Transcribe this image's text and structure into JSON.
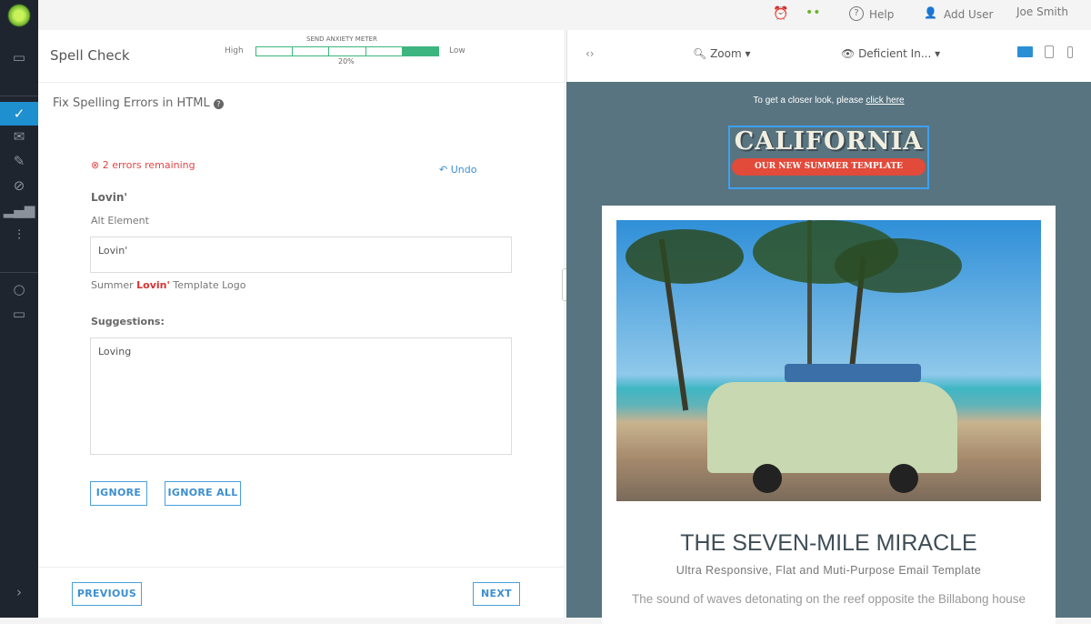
{
  "topbar": {
    "help": "Help",
    "add_user": "Add User",
    "user": "Joe Smith"
  },
  "header": {
    "title": "Spell Check",
    "meter": {
      "title": "SEND ANXIETY METER",
      "high": "High",
      "low": "Low",
      "value_label": "20%",
      "value": 20,
      "segments": 5,
      "filled_segments": 1,
      "color": "#3db57e"
    }
  },
  "section_title": "Fix Spelling Errors in HTML",
  "errors": "2 errors remaining",
  "undo": "Undo",
  "word": "Lovin'",
  "element_type": "Alt Element",
  "field_value": "Lovin'",
  "context": {
    "before": "Summer ",
    "word": "Lovin'",
    "after": " Template Logo"
  },
  "suggestions_label": "Suggestions:",
  "suggestions": [
    "Loving"
  ],
  "buttons": {
    "ignore": "IGNORE",
    "ignore_all": "IGNORE ALL",
    "previous": "PREVIOUS",
    "next": "NEXT"
  },
  "preview": {
    "zoom": "Zoom",
    "deficiency": "Deficient In...",
    "closer_text": "To get a closer look, please ",
    "closer_link": "click here",
    "logo_title": "CALIFORNIA",
    "logo_sub": "OUR NEW SUMMER TEMPLATE",
    "headline": "THE SEVEN-MILE MIRACLE",
    "subhead": "Ultra Responsive, Flat and Muti-Purpose Email Template",
    "body": "The sound of waves detonating on the reef opposite the Billabong house"
  }
}
